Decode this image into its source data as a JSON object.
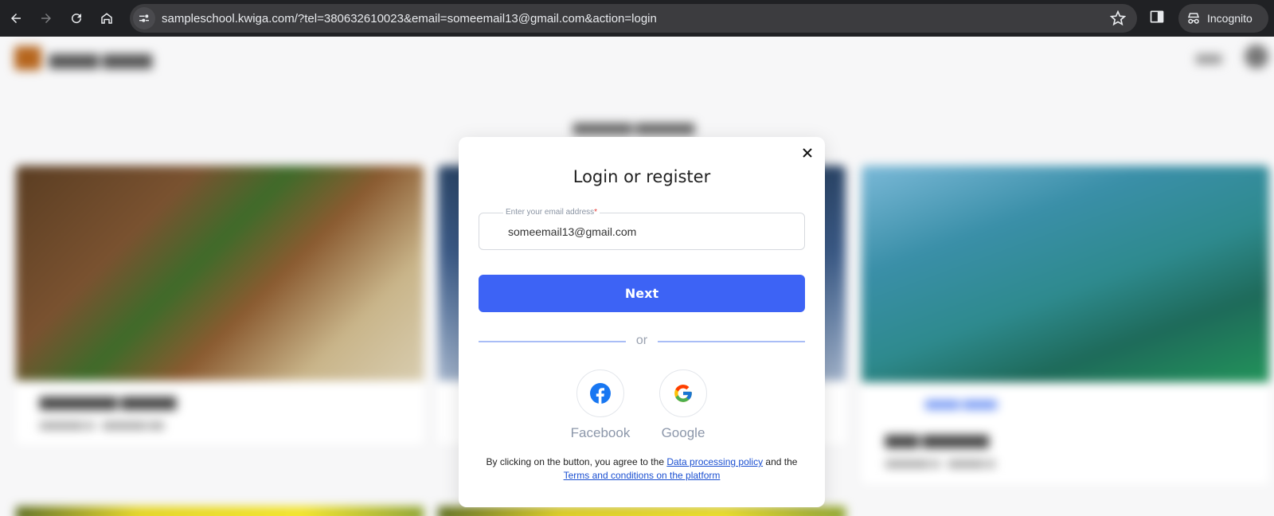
{
  "browser": {
    "url": "sampleschool.kwiga.com/?tel=380632610023&email=someemail13@gmail.com&action=login",
    "profile_label": "Incognito",
    "icons": [
      "back-icon",
      "forward-icon",
      "reload-icon",
      "home-icon",
      "site-info-icon",
      "bookmark-star-icon",
      "side-panel-icon",
      "incognito-icon"
    ]
  },
  "modal": {
    "title": "Login or register",
    "email_label": "Enter your email address",
    "email_required_mark": "*",
    "email_value": "someemail13@gmail.com",
    "next_label": "Next",
    "or_label": "or",
    "facebook_label": "Facebook",
    "google_label": "Google",
    "terms_prefix": "By clicking on the button, you agree to the",
    "data_policy_link": "Data processing policy",
    "terms_middle": "and the",
    "terms_link": "Terms and conditions on the platform"
  },
  "colors": {
    "primary": "#3d63f5",
    "link": "#1a4fd1",
    "facebook": "#1877f2",
    "chrome_bg": "#202124"
  }
}
